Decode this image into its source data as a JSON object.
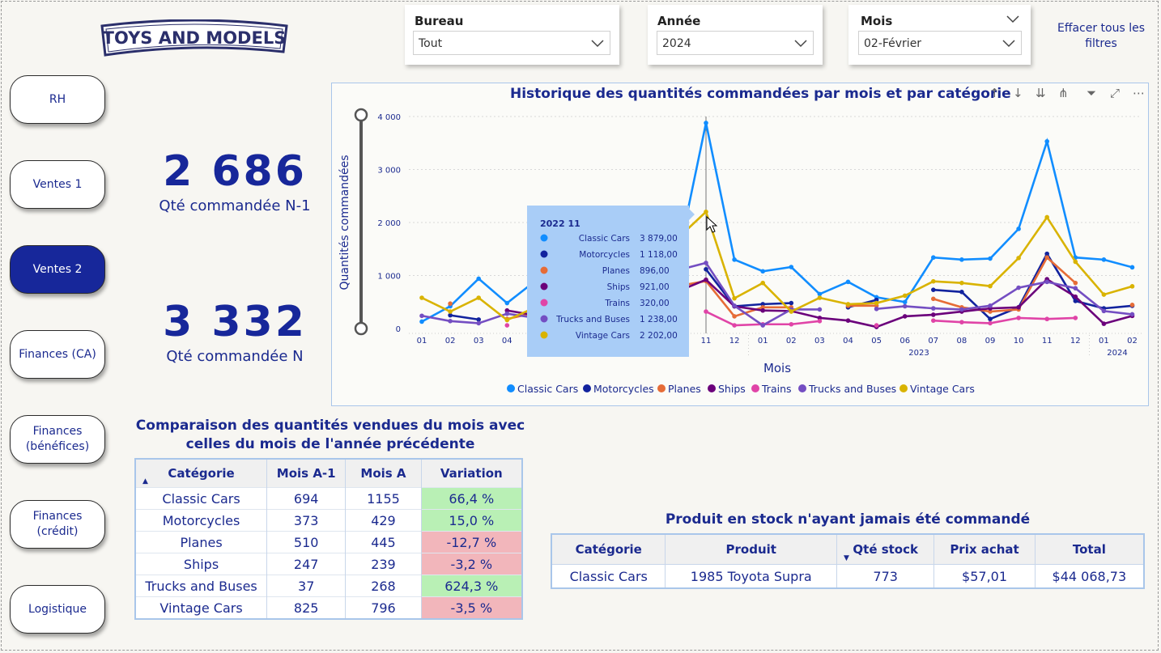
{
  "logo": {
    "text": "TOYS AND MODELS"
  },
  "nav": [
    {
      "label": "RH",
      "active": false
    },
    {
      "label": "Ventes 1",
      "active": false
    },
    {
      "label": "Ventes 2",
      "active": true
    },
    {
      "label": "Finances (CA)",
      "active": false
    },
    {
      "label": "Finances (bénéfices)",
      "active": false
    },
    {
      "label": "Finances (crédit)",
      "active": false
    },
    {
      "label": "Logistique",
      "active": false
    }
  ],
  "kpis": [
    {
      "value": "2 686",
      "label": "Qté commandée N-1"
    },
    {
      "value": "3 332",
      "label": "Qté commandée N"
    }
  ],
  "filters": [
    {
      "title": "Bureau",
      "value": "Tout"
    },
    {
      "title": "Année",
      "value": "2024"
    },
    {
      "title": "Mois",
      "value": "02-Février"
    }
  ],
  "clear_filters": "Effacer tous les filtres",
  "chart_title": "Historique des quantités commandées par mois et par catégorie",
  "chart_data": {
    "type": "line",
    "ylabel": "Quantités commandées",
    "xlabel": "Mois",
    "ylim": [
      0,
      4000
    ],
    "yticks": [
      "4 000",
      "3 000",
      "2 000",
      "1 000",
      "0"
    ],
    "x": [
      "01",
      "02",
      "03",
      "04",
      "05",
      "06",
      "07",
      "08",
      "09",
      "10",
      "11",
      "12",
      "01",
      "02",
      "03",
      "04",
      "05",
      "06",
      "07",
      "08",
      "09",
      "10",
      "11",
      "12",
      "01",
      "02"
    ],
    "year_labels": [
      {
        "label": "2023",
        "at_index": 18
      },
      {
        "label": "2024",
        "at_index": 25
      }
    ],
    "series": [
      {
        "name": "Classic Cars",
        "color": "#118dff",
        "values": [
          130,
          420,
          940,
          480,
          900,
          800,
          900,
          850,
          750,
          1300,
          3879,
          1300,
          1080,
          1160,
          650,
          880,
          590,
          500,
          1340,
          1300,
          1320,
          1880,
          3530,
          1340,
          1300,
          1155
        ]
      },
      {
        "name": "Motorcycles",
        "color": "#12239e",
        "values": [
          null,
          250,
          170,
          null,
          null,
          null,
          null,
          null,
          null,
          null,
          1118,
          420,
          460,
          480,
          null,
          400,
          540,
          null,
          730,
          690,
          180,
          400,
          1410,
          520,
          380,
          429
        ]
      },
      {
        "name": "Planes",
        "color": "#e66c37",
        "values": [
          null,
          470,
          null,
          180,
          300,
          null,
          null,
          null,
          null,
          800,
          896,
          230,
          400,
          400,
          null,
          430,
          430,
          null,
          560,
          400,
          320,
          360,
          1340,
          860,
          null,
          445
        ]
      },
      {
        "name": "Ships",
        "color": "#6b007b",
        "values": [
          null,
          null,
          null,
          340,
          250,
          null,
          null,
          null,
          null,
          700,
          921,
          420,
          340,
          330,
          200,
          150,
          30,
          230,
          260,
          320,
          380,
          400,
          930,
          600,
          90,
          239
        ]
      },
      {
        "name": "Trains",
        "color": "#e044a7",
        "values": [
          null,
          null,
          null,
          60,
          null,
          null,
          null,
          null,
          null,
          null,
          320,
          60,
          80,
          80,
          140,
          null,
          60,
          null,
          150,
          120,
          100,
          200,
          180,
          200,
          null,
          null
        ]
      },
      {
        "name": "Trucks and Buses",
        "color": "#744ec2",
        "values": [
          240,
          140,
          100,
          280,
          200,
          null,
          null,
          null,
          null,
          1100,
          1238,
          430,
          60,
          360,
          360,
          null,
          370,
          420,
          380,
          360,
          430,
          770,
          880,
          760,
          330,
          268
        ]
      },
      {
        "name": "Vintage Cars",
        "color": "#d9b300",
        "values": [
          580,
          320,
          580,
          160,
          400,
          null,
          null,
          null,
          null,
          1700,
          2202,
          570,
          860,
          320,
          580,
          460,
          480,
          620,
          890,
          860,
          800,
          1330,
          2100,
          1260,
          640,
          796
        ]
      }
    ],
    "tooltip": {
      "title": "2022 11",
      "rows": [
        {
          "name": "Classic Cars",
          "value": "3 879,00"
        },
        {
          "name": "Motorcycles",
          "value": "1 118,00"
        },
        {
          "name": "Planes",
          "value": "896,00"
        },
        {
          "name": "Ships",
          "value": "921,00"
        },
        {
          "name": "Trains",
          "value": "320,00"
        },
        {
          "name": "Trucks and Buses",
          "value": "1 238,00"
        },
        {
          "name": "Vintage Cars",
          "value": "2 202,00"
        }
      ]
    }
  },
  "comparison": {
    "title_line1": "Comparaison des quantités vendues du mois avec",
    "title_line2": "celles du mois de l'année précédente",
    "headers": [
      "Catégorie",
      "Mois A-1",
      "Mois A",
      "Variation"
    ],
    "rows": [
      {
        "cat": "Classic Cars",
        "prev": "694",
        "cur": "1155",
        "var": "66,4 %",
        "trend": "pos"
      },
      {
        "cat": "Motorcycles",
        "prev": "373",
        "cur": "429",
        "var": "15,0 %",
        "trend": "pos"
      },
      {
        "cat": "Planes",
        "prev": "510",
        "cur": "445",
        "var": "-12,7 %",
        "trend": "neg"
      },
      {
        "cat": "Ships",
        "prev": "247",
        "cur": "239",
        "var": "-3,2 %",
        "trend": "neg"
      },
      {
        "cat": "Trucks and Buses",
        "prev": "37",
        "cur": "268",
        "var": "624,3 %",
        "trend": "pos"
      },
      {
        "cat": "Vintage Cars",
        "prev": "825",
        "cur": "796",
        "var": "-3,5 %",
        "trend": "neg"
      }
    ]
  },
  "stock": {
    "title": "Produit en stock n'ayant jamais été commandé",
    "headers": [
      "Catégorie",
      "Produit",
      "Qté stock",
      "Prix achat",
      "Total"
    ],
    "rows": [
      {
        "cat": "Classic Cars",
        "prod": "1985 Toyota Supra",
        "qty": "773",
        "price": "$57,01",
        "total": "$44 068,73"
      }
    ]
  }
}
